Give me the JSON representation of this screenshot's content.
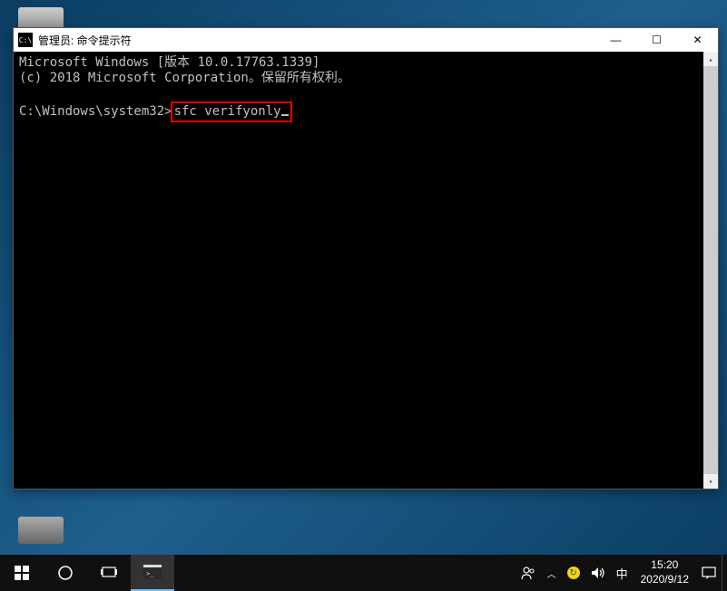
{
  "window": {
    "title": "管理员: 命令提示符",
    "icon_label": "C:\\"
  },
  "terminal": {
    "line1": "Microsoft Windows [版本 10.0.17763.1339]",
    "line2": "(c) 2018 Microsoft Corporation。保留所有权利。",
    "prompt": "C:\\Windows\\system32>",
    "command": "sfc verifyonly"
  },
  "taskbar": {
    "ime": "中",
    "time": "15:20",
    "date": "2020/9/12"
  },
  "icons": {
    "minimize": "—",
    "maximize": "☐",
    "close": "✕",
    "scroll_up": "▴",
    "scroll_down": "▾",
    "cortana": "○",
    "taskview": "",
    "people": "",
    "tray_up": "˄",
    "speaker": "🔊",
    "notifications": "💬"
  }
}
